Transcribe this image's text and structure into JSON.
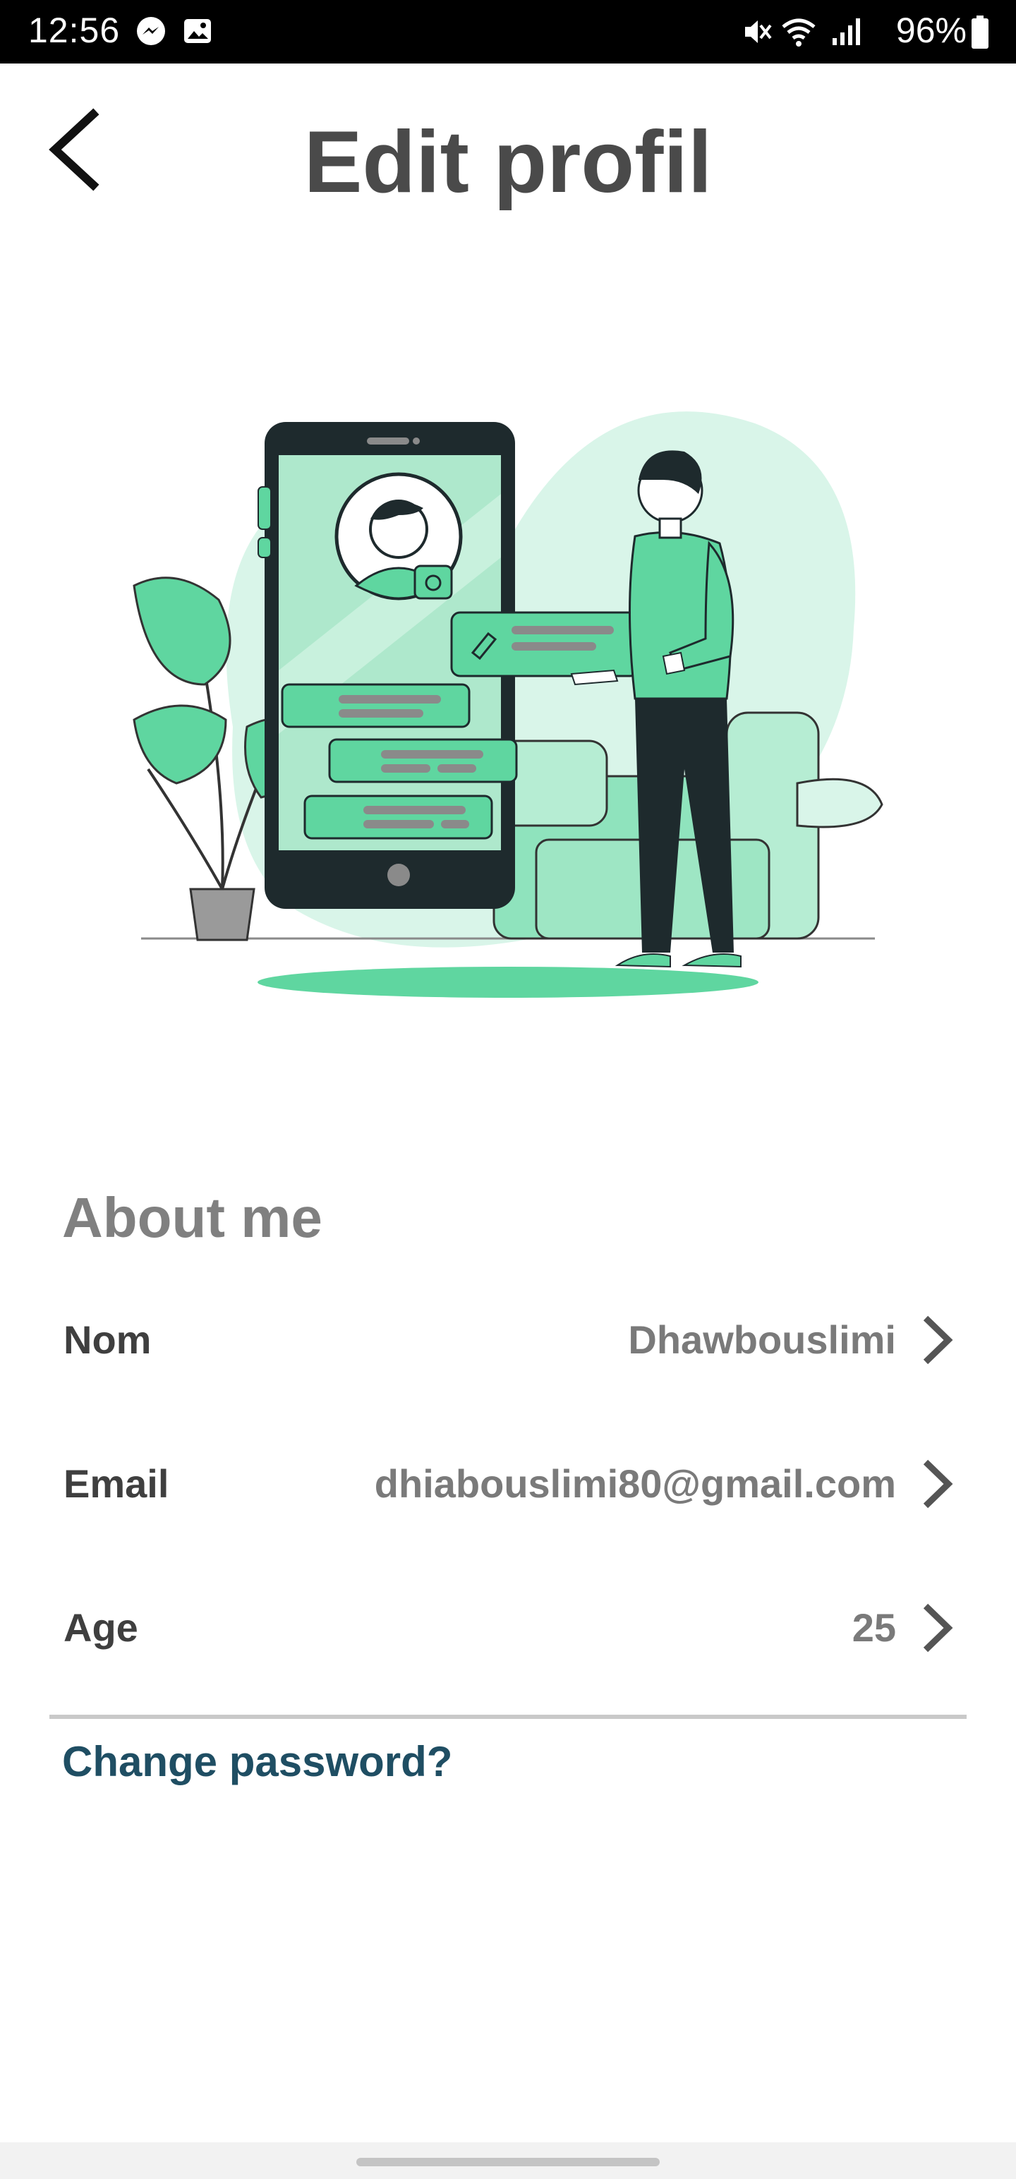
{
  "status_bar": {
    "time": "12:56",
    "battery": "96%",
    "icons": [
      "messenger-icon",
      "gallery-icon",
      "mute-icon",
      "wifi-icon",
      "signal-icon",
      "battery-icon"
    ]
  },
  "header": {
    "title": "Edit profil",
    "back_icon": "chevron-left-icon"
  },
  "illustration": {
    "name": "profile-edit-illustration",
    "colors": {
      "accent": "#5fd6a0",
      "light": "#d9f5e9",
      "mid": "#8fe3bd",
      "dark": "#1e2a2d",
      "gray": "#8a8a8a"
    }
  },
  "about": {
    "title": "About me",
    "rows": [
      {
        "label": "Nom",
        "value": "Dhawbouslimi"
      },
      {
        "label": "Email",
        "value": "dhiabouslimi80@gmail.com"
      },
      {
        "label": "Age",
        "value": "25"
      }
    ]
  },
  "change_password": "Change password?",
  "colors": {
    "title": "#4a4a4a",
    "section": "#808080",
    "label": "#3f3f3f",
    "value": "#7a7a7a",
    "link": "#1f4e63",
    "divider": "#c9c9c9"
  }
}
